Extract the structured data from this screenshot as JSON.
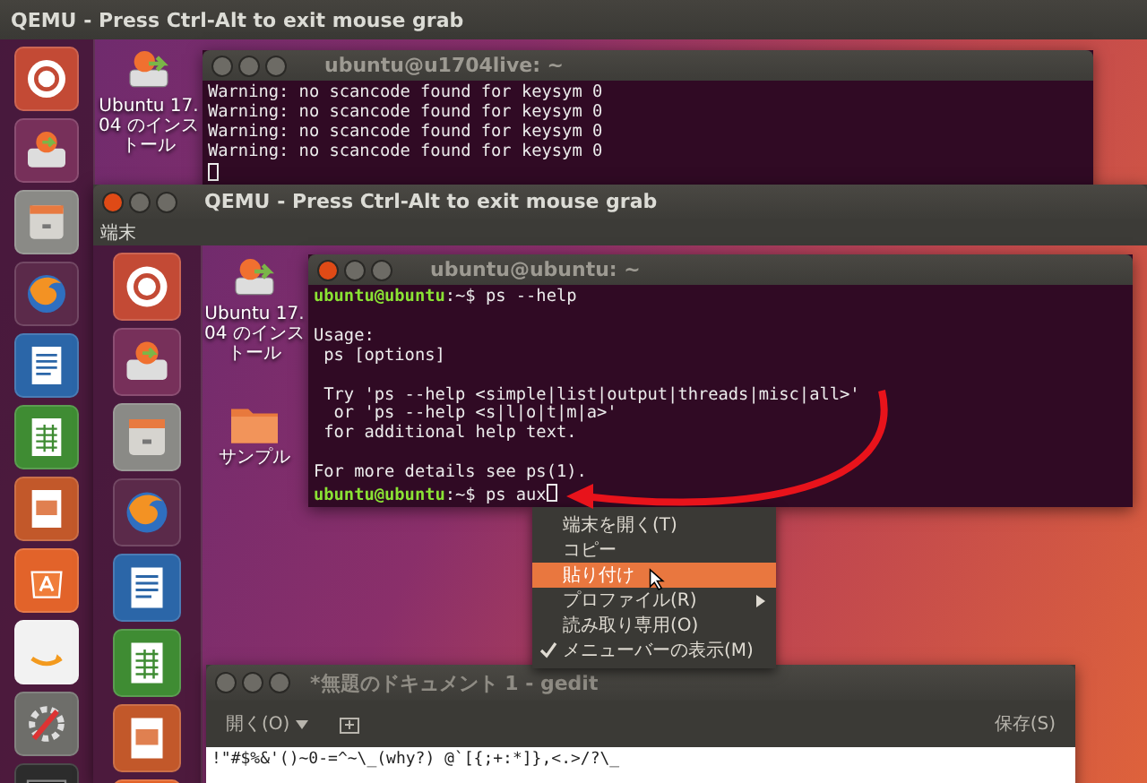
{
  "outer_window": {
    "title": "QEMU - Press Ctrl-Alt to exit mouse grab"
  },
  "outer_desktop": {
    "icons": [
      {
        "label": "Ubuntu 17.04 のインストール"
      }
    ]
  },
  "terminal_1": {
    "title": "ubuntu@u1704live: ~",
    "blocks": [
      {
        "lines": [
          {
            "text": "Warning: no scancode found for keysym 0"
          },
          {
            "text": "Warning: no scancode found for keysym 0"
          },
          {
            "text": "Warning: no scancode found for keysym 0"
          },
          {
            "text": "Warning: no scancode found for keysym 0"
          }
        ]
      }
    ]
  },
  "inner_window": {
    "title": "QEMU - Press Ctrl-Alt to exit mouse grab",
    "menu": [
      "端末"
    ]
  },
  "inner_desktop": {
    "icons": [
      {
        "label": "Ubuntu 17.04 のインストール",
        "kind": "installer"
      },
      {
        "label": "サンプル",
        "kind": "folder"
      }
    ]
  },
  "terminal_2": {
    "title": "ubuntu@ubuntu: ~",
    "blocks": [
      {
        "lines": [
          {
            "prompt": "ubuntu@ubuntu",
            "text": ":~$ ps --help"
          }
        ]
      },
      {
        "lines": [
          {
            "text": "Usage:"
          },
          {
            "text": " ps [options]"
          }
        ]
      },
      {
        "lines": [
          {
            "text": " Try 'ps --help <simple|list|output|threads|misc|all>'"
          },
          {
            "text": "  or 'ps --help <s|l|o|t|m|a>'"
          },
          {
            "text": " for additional help text."
          }
        ]
      },
      {
        "lines": [
          {
            "text": "For more details see ps(1)."
          },
          {
            "prompt": "ubuntu@ubuntu",
            "text": ":~$ ps aux"
          }
        ]
      }
    ]
  },
  "context_menu": {
    "items": [
      {
        "label": "端末を開く(T)",
        "selected": false,
        "checked": false,
        "submenu": false
      },
      {
        "label": "コピー",
        "selected": false,
        "checked": false,
        "submenu": false
      },
      {
        "label": "貼り付け",
        "selected": true,
        "checked": false,
        "submenu": false
      },
      {
        "label": "プロファイル(R)",
        "selected": false,
        "checked": false,
        "submenu": true
      },
      {
        "label": "読み取り専用(O)",
        "selected": false,
        "checked": false,
        "submenu": false
      },
      {
        "label": "メニューバーの表示(M)",
        "selected": false,
        "checked": true,
        "submenu": false
      }
    ]
  },
  "gedit": {
    "title": "*無題のドキュメント 1 - gedit",
    "open_button": "開く(O)",
    "save_button": "保存(S)",
    "text": "!\"#$%&'()~0-=^~\\_(why?) @`[{;+:*]},<.>/?\\_"
  }
}
